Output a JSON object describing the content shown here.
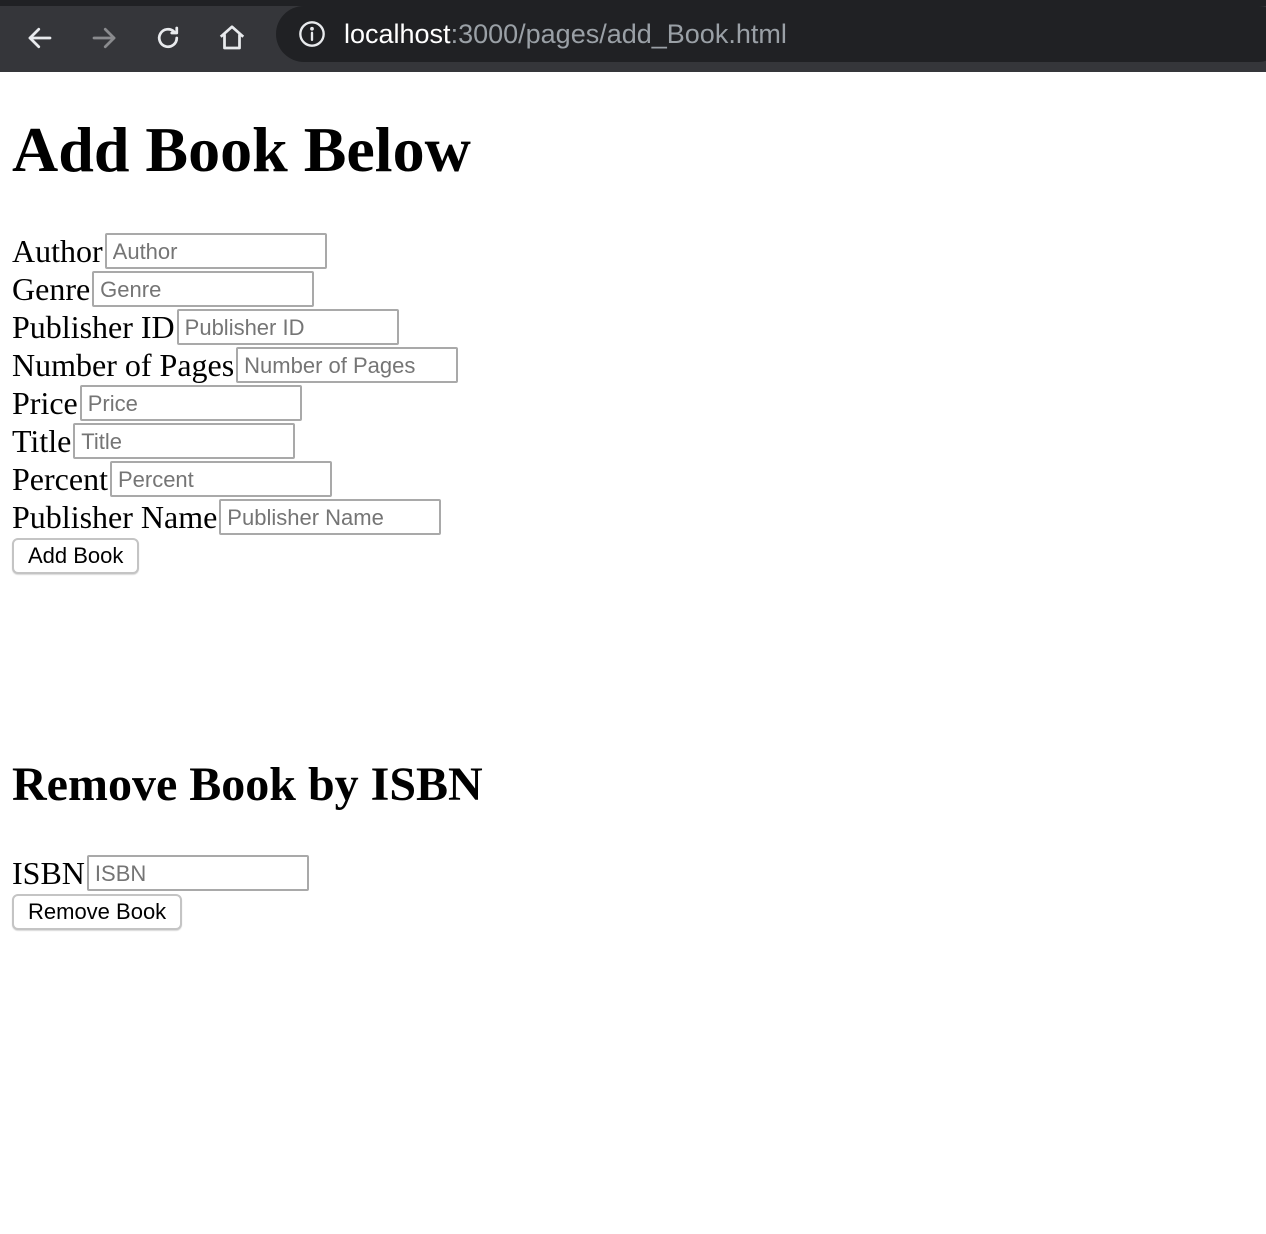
{
  "browser": {
    "url_host": "localhost",
    "url_path": ":3000/pages/add_Book.html"
  },
  "add_section": {
    "heading": "Add Book Below",
    "fields": [
      {
        "label": "Author",
        "placeholder": "Author",
        "value": ""
      },
      {
        "label": "Genre",
        "placeholder": "Genre",
        "value": ""
      },
      {
        "label": "Publisher ID",
        "placeholder": "Publisher ID",
        "value": ""
      },
      {
        "label": "Number of Pages",
        "placeholder": "Number of Pages",
        "value": ""
      },
      {
        "label": "Price",
        "placeholder": "Price",
        "value": ""
      },
      {
        "label": "Title",
        "placeholder": "Title",
        "value": ""
      },
      {
        "label": "Percent",
        "placeholder": "Percent",
        "value": ""
      },
      {
        "label": "Publisher Name",
        "placeholder": "Publisher Name",
        "value": ""
      }
    ],
    "submit_label": "Add Book"
  },
  "remove_section": {
    "heading": "Remove Book by ISBN",
    "field": {
      "label": "ISBN",
      "placeholder": "ISBN",
      "value": ""
    },
    "submit_label": "Remove Book"
  },
  "icons": {
    "back": "arrow-left-icon",
    "forward": "arrow-right-icon",
    "reload": "reload-icon",
    "home": "home-icon",
    "info": "info-icon"
  }
}
